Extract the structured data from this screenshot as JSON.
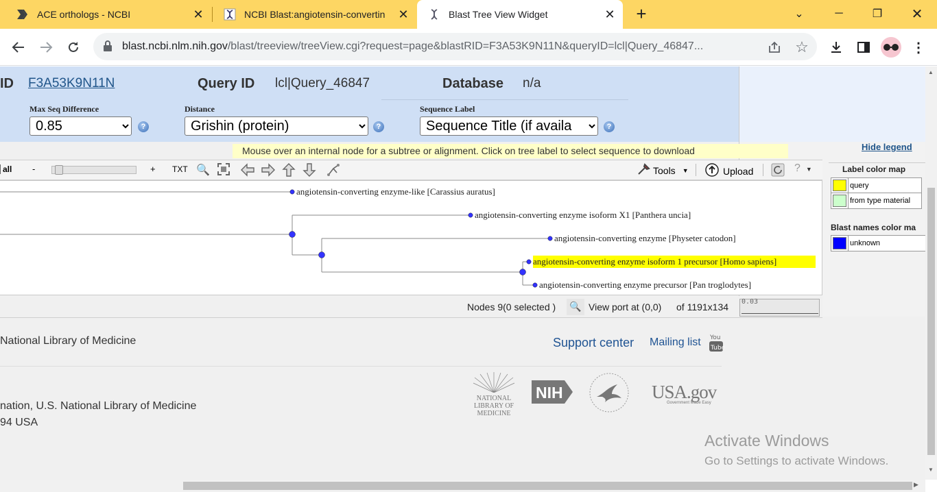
{
  "tabs": [
    {
      "title": "ACE orthologs - NCBI",
      "icon": "bookmark-arrow-icon"
    },
    {
      "title": "NCBI Blast:angiotensin-convertin",
      "icon": "dna-helix-icon"
    },
    {
      "title": "Blast Tree View Widget",
      "icon": "dna-helix-icon"
    }
  ],
  "address": {
    "host": "blast.ncbi.nlm.nih.gov",
    "path": "/blast/treeview/treeView.cgi?request=page&blastRID=F3A53K9N11N&queryID=lcl|Query_46847..."
  },
  "info": {
    "rid_label": "ID",
    "rid_value": "F3A53K9N11N",
    "query_label": "Query ID",
    "query_value": "lcl|Query_46847",
    "db_label": "Database",
    "db_value": "n/a"
  },
  "controls": {
    "max_seq_label": "Max Seq Difference",
    "max_seq_value": "0.85",
    "distance_label": "Distance",
    "distance_value": "Grishin (protein)",
    "seq_label_label": "Sequence Label",
    "seq_label_value": "Sequence Title (if availa"
  },
  "hint": "Mouse over an internal node for a subtree or alignment. Click on tree label to select sequence to download",
  "toolbar": {
    "all": "all",
    "minus": "-",
    "plus": "+",
    "txt": "TXT",
    "tools": "Tools",
    "upload": "Upload",
    "slider_level": 0.05
  },
  "tree": {
    "leaves": [
      "angiotensin-converting enzyme-like [Carassius auratus]",
      "angiotensin-converting enzyme isoform X1 [Panthera uncia]",
      "angiotensin-converting enzyme [Physeter catodon]",
      "angiotensin-converting enzyme isoform 1 precursor [Homo sapiens]",
      "angiotensin-converting enzyme precursor [Pan troglodytes]"
    ],
    "query_highlight_color": "#ffff00",
    "node_color": "#3333ff"
  },
  "status": {
    "nodes": "Nodes 9(0 selected )",
    "viewport": "View port at (0,0)",
    "of": "of 1191x134",
    "scale": "0.03"
  },
  "legend": {
    "hide": "Hide legend",
    "label_map_title": "Label color map",
    "label_items": [
      {
        "name": "query",
        "color": "#ffff00"
      },
      {
        "name": "from type material",
        "color": "#ccffcc"
      }
    ],
    "blast_map_title": "Blast names color ma",
    "blast_items": [
      {
        "name": "unknown",
        "color": "#0000ff"
      }
    ]
  },
  "footer": {
    "nlm": "National Library of Medicine",
    "support": "Support center",
    "mailing": "Mailing list",
    "addr1": "nation, U.S. National Library of Medicine",
    "addr2": "94 USA",
    "nlm_logo": [
      "NATIONAL",
      "LIBRARY OF",
      "MEDICINE"
    ],
    "nih_logo": "NIH",
    "usa_logo": "USA.gov",
    "usa_sub": "Government Made Easy"
  },
  "watermark": {
    "title": "Activate Windows",
    "sub": "Go to Settings to activate Windows."
  }
}
